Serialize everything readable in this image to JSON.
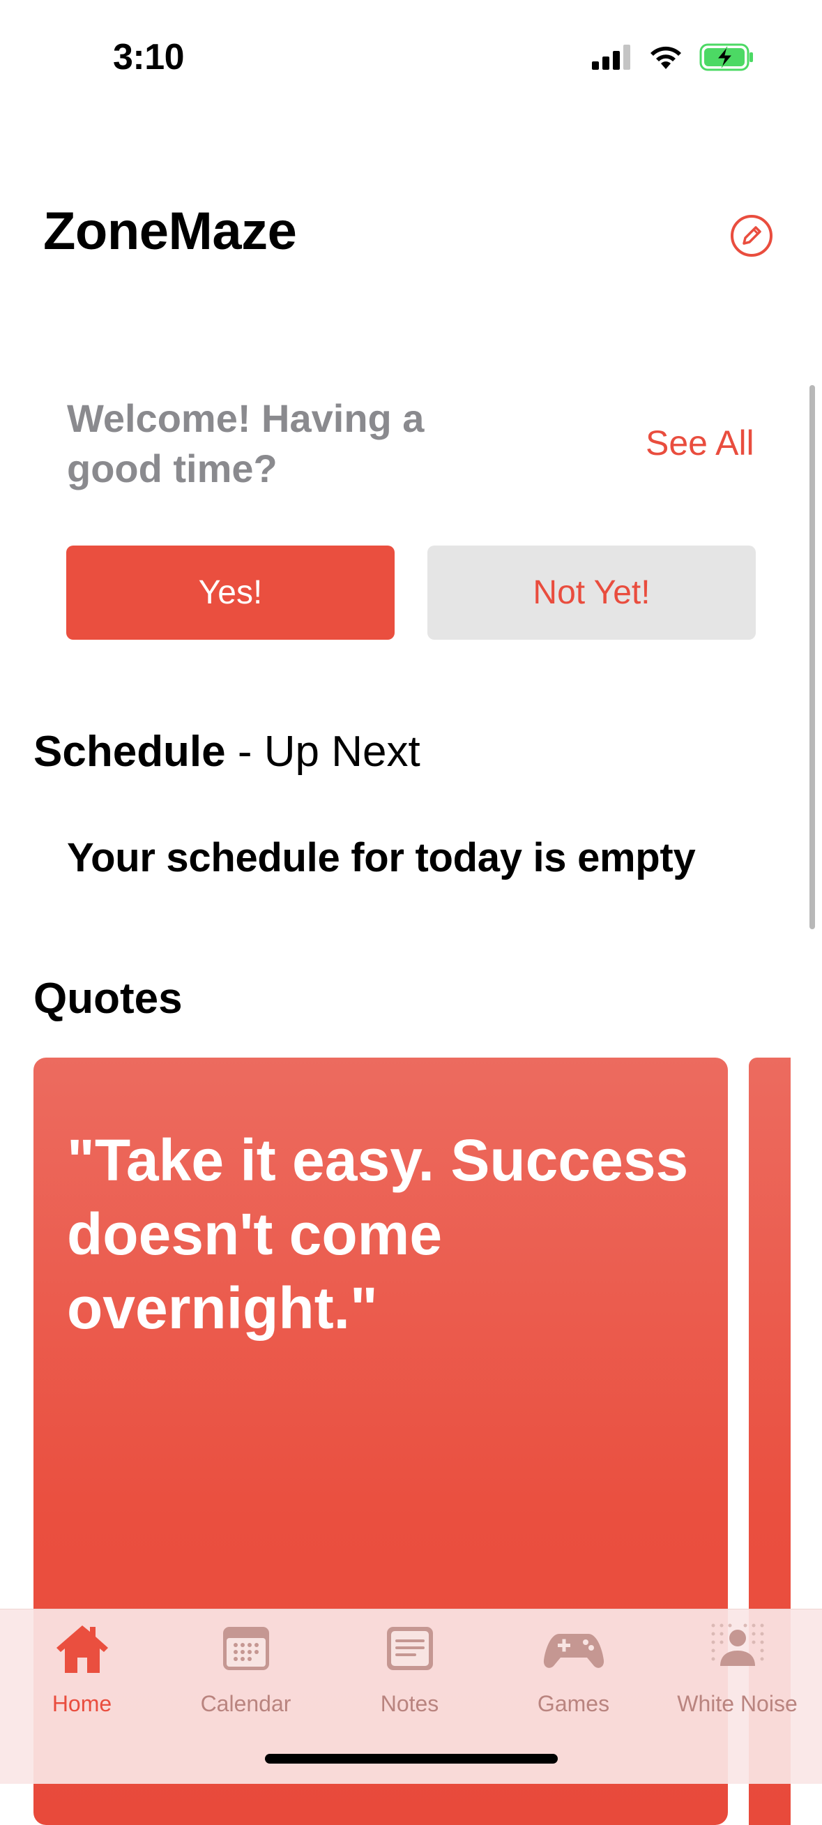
{
  "status_bar": {
    "time": "3:10"
  },
  "header": {
    "title": "ZoneMaze",
    "edit_icon": "pencil-circle-icon"
  },
  "welcome": {
    "prompt": "Welcome! Having a good time?",
    "see_all_label": "See All",
    "yes_label": "Yes!",
    "not_yet_label": "Not Yet!"
  },
  "schedule": {
    "heading_bold": "Schedule",
    "heading_rest": " - Up Next",
    "empty_message": "Your schedule for today is empty"
  },
  "quotes": {
    "heading": "Quotes",
    "items": [
      {
        "text": "\"Take it easy. Success doesn't come overnight.\""
      }
    ]
  },
  "tab_bar": {
    "tabs": [
      {
        "label": "Home",
        "icon": "house-icon",
        "active": true
      },
      {
        "label": "Calendar",
        "icon": "calendar-icon",
        "active": false
      },
      {
        "label": "Notes",
        "icon": "notes-icon",
        "active": false
      },
      {
        "label": "Games",
        "icon": "gamecontroller-icon",
        "active": false
      },
      {
        "label": "White Noise",
        "icon": "white-noise-icon",
        "active": false
      }
    ]
  },
  "colors": {
    "accent": "#ea4f3f",
    "secondary_button_bg": "#e5e5e5",
    "inactive_tab": "#b9847f",
    "battery_green": "#4cd964"
  }
}
